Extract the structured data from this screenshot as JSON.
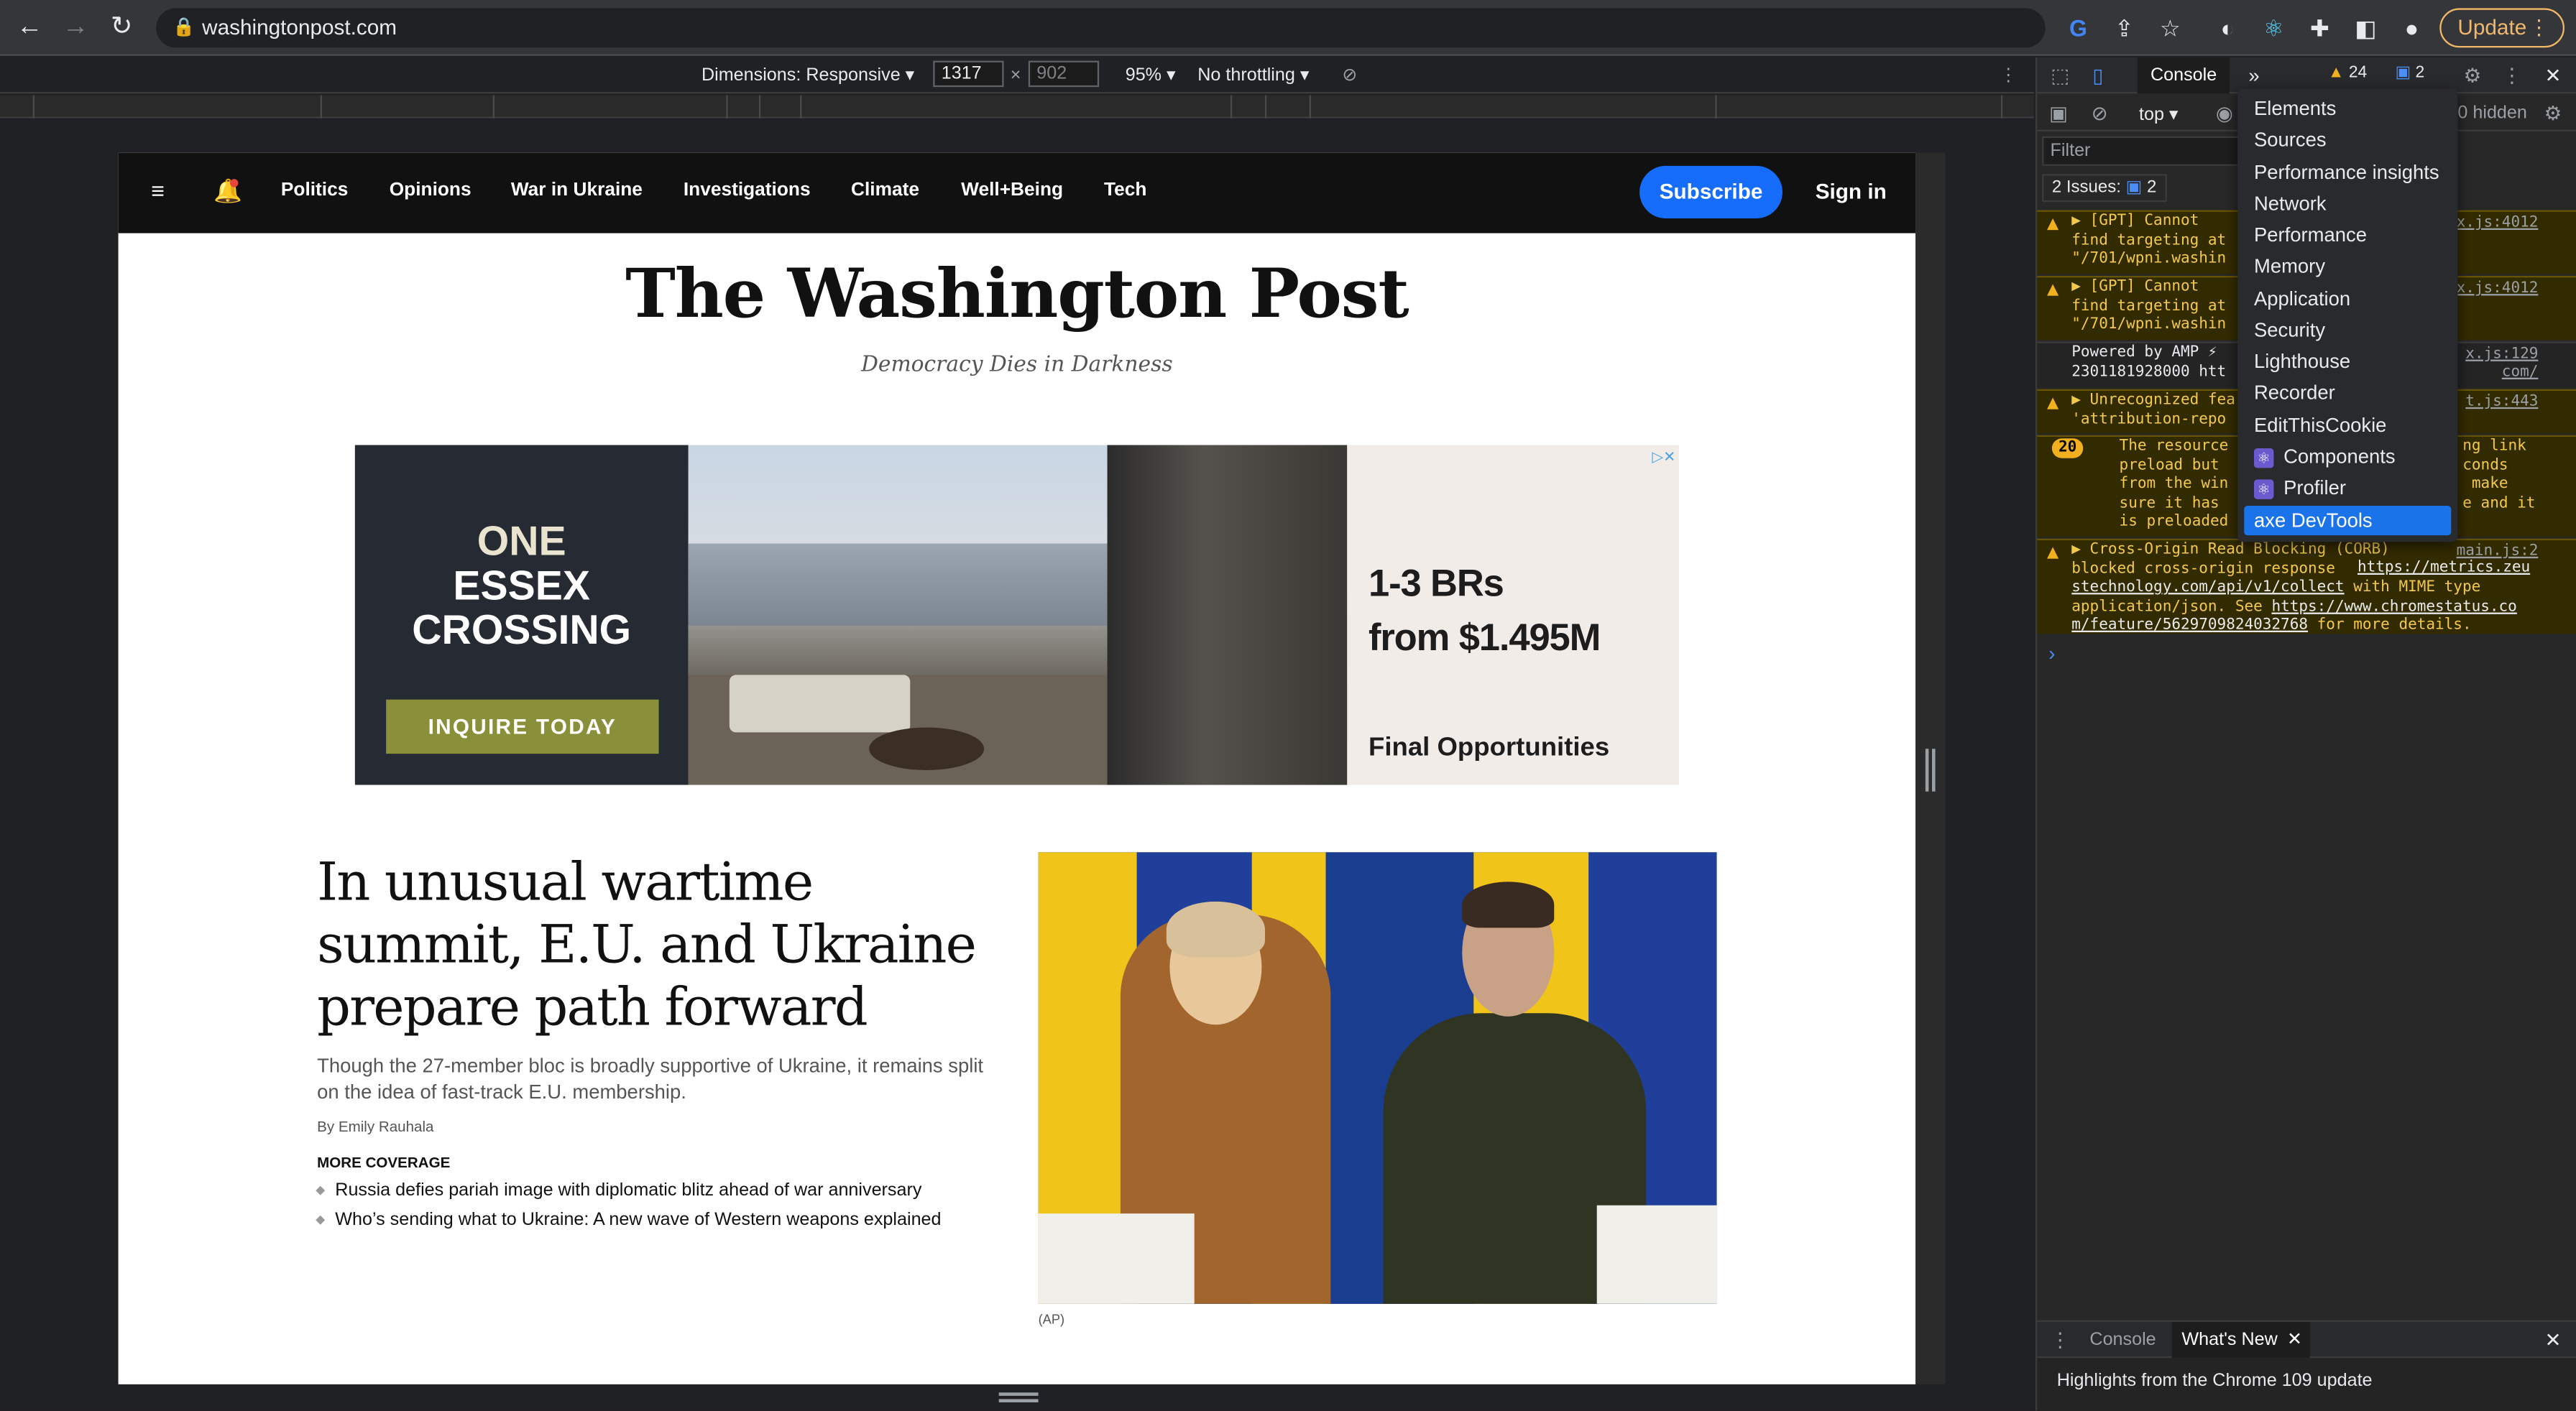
{
  "browser": {
    "url": "washingtonpost.com",
    "update_label": "Update"
  },
  "device_toolbar": {
    "dimensions_label": "Dimensions: Responsive ▾",
    "width_value": "1317",
    "height_value": "902",
    "zoom": "95% ▾",
    "throttling": "No throttling ▾"
  },
  "site": {
    "nav_links": [
      "Politics",
      "Opinions",
      "War in Ukraine",
      "Investigations",
      "Climate",
      "Well+Being",
      "Tech"
    ],
    "subscribe_label": "Subscribe",
    "signin_label": "Sign in",
    "masthead": "The Washington Post",
    "tagline": "Democracy Dies in Darkness"
  },
  "ad": {
    "logo_line1": "ONE",
    "logo_line2": "ESSEX",
    "logo_line3": "CROSSING",
    "cta": "INQUIRE TODAY",
    "price_line1": "1-3 BRs",
    "price_line2": "from $1.495M",
    "final": "Final Opportunities"
  },
  "story": {
    "headline": "In unusual wartime summit, E.U. and Ukraine prepare path forward",
    "dek": "Though the 27-member bloc is broadly supportive of Ukraine, it remains split on the idea of fast-track E.U. membership.",
    "byline": "By Emily Rauhala",
    "more_coverage_label": "MORE COVERAGE",
    "related": [
      "Russia defies pariah image with diplomatic blitz ahead of war anniversary",
      "Who’s sending what to Ukraine: A new wave of Western weapons explained"
    ],
    "photo_credit": "(AP)"
  },
  "devtools": {
    "active_tab": "Console",
    "warnings_count": "24",
    "messages_count": "2",
    "context": "top ▾",
    "hidden_label": "0 hidden",
    "filter_placeholder": "Filter",
    "issues_label": "2 Issues:",
    "issues_count": "2",
    "logs": [
      {
        "text": "▶ [GPT] Cannot\nfind targeting at\n\"/701/wpni.washin",
        "src": "x.js:4012"
      },
      {
        "text": "▶ [GPT] Cannot\nfind targeting at\n\"/701/wpni.washin",
        "src": "x.js:4012"
      },
      {
        "text": "Powered by AMP ⚡\n2301181928000 htt",
        "src": "x.js:129",
        "src2": "com/"
      },
      {
        "text": "▶ Unrecognized fea\n'attribution-repo",
        "src": "t.js:443"
      },
      {
        "count": "20",
        "text": "The resource\npreload but\nfrom the win\nsure it has\nis preloaded",
        "right": "ng link\nconds\n make\ne and it"
      },
      {
        "text": "▶ Cross-Origin Read Blocking (CORB)\nblocked cross-origin response",
        "src": "main.js:2",
        "link1": "https://metrics.zeu",
        "link1b": "stechnology.com/api/v1/collect",
        "mid": " with MIME type",
        "mid2": "application/json. See ",
        "link2": "https://www.chromestatus.co",
        "link2b": "m/feature/5629709824032768",
        "tail": " for more details."
      }
    ],
    "menu_items": [
      "Elements",
      "Sources",
      "Performance insights",
      "Network",
      "Performance",
      "Memory",
      "Application",
      "Security",
      "Lighthouse",
      "Recorder",
      "EditThisCookie",
      "Components",
      "Profiler",
      "axe DevTools"
    ],
    "drawer_tabs": [
      "Console",
      "What's New"
    ],
    "drawer_text": "Highlights from the Chrome 109 update"
  }
}
